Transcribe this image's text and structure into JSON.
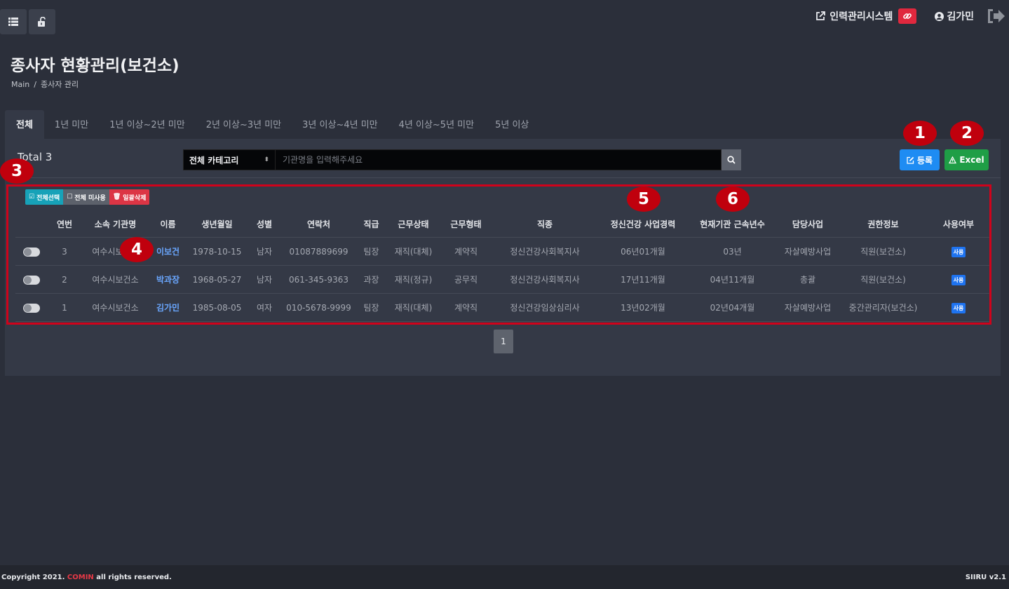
{
  "header": {
    "system_link_label": "인력관리시스템",
    "user_name": "김가민"
  },
  "page": {
    "title": "종사자 현황관리(보건소)",
    "breadcrumb": [
      "Main",
      "종사자 관리"
    ]
  },
  "tabs": [
    {
      "label": "전체",
      "active": true
    },
    {
      "label": "1년 미만"
    },
    {
      "label": "1년 이상~2년 미만"
    },
    {
      "label": "2년 이상~3년 미만"
    },
    {
      "label": "3년 이상~4년 미만"
    },
    {
      "label": "4년 이상~5년 미만"
    },
    {
      "label": "5년 이상"
    }
  ],
  "toolbar": {
    "total_label": "Total 3",
    "category_select": "전체 카테고리",
    "search_placeholder": "기관명을 입력해주세요",
    "register_label": "등록",
    "excel_label": "Excel"
  },
  "bulk_actions": {
    "select_all": "전체선택",
    "unuse_all": "전체 미사용",
    "bulk_delete": "일괄삭제"
  },
  "table": {
    "columns": [
      "",
      "연번",
      "소속 기관명",
      "이름",
      "생년월일",
      "성별",
      "연락처",
      "직급",
      "근무상태",
      "근무형태",
      "직종",
      "정신건강 사업경력",
      "현재기관 근속년수",
      "담당사업",
      "권한정보",
      "사용여부"
    ],
    "rows": [
      {
        "no": "3",
        "org": "여수시보건소",
        "name": "이보건",
        "birth": "1978-10-15",
        "gender": "남자",
        "phone": "01087889699",
        "rank": "팀장",
        "status": "재직(대체)",
        "type": "계약직",
        "job": "정신건강사회복지사",
        "career": "06년01개월",
        "tenure": "03년",
        "project": "자살예방사업",
        "role": "직원(보건소)",
        "use": "사용"
      },
      {
        "no": "2",
        "org": "여수시보건소",
        "name": "박과장",
        "birth": "1968-05-27",
        "gender": "남자",
        "phone": "061-345-9363",
        "rank": "과장",
        "status": "재직(정규)",
        "type": "공무직",
        "job": "정신건강사회복지사",
        "career": "17년11개월",
        "tenure": "04년11개월",
        "project": "총괄",
        "role": "직원(보건소)",
        "use": "사용"
      },
      {
        "no": "1",
        "org": "여수시보건소",
        "name": "김가민",
        "birth": "1985-08-05",
        "gender": "여자",
        "phone": "010-5678-9999",
        "rank": "팀장",
        "status": "재직(대체)",
        "type": "계약직",
        "job": "정신건강임상심리사",
        "career": "13년02개월",
        "tenure": "02년04개월",
        "project": "자살예방사업",
        "role": "중간관리자(보건소)",
        "use": "사용"
      }
    ]
  },
  "pagination": {
    "current": "1"
  },
  "annotations": [
    "1",
    "2",
    "3",
    "4",
    "5",
    "6"
  ],
  "footer": {
    "copyright_prefix": "Copyright 2021.",
    "brand": "COMIN",
    "copyright_suffix": "all rights reserved.",
    "version": "SIIRU v2.1"
  },
  "colors": {
    "background": "#2b2f3a",
    "panel": "#343946",
    "primary": "#1e8cf3",
    "success": "#1f9e46",
    "danger": "#dc3545",
    "info": "#17a2b8",
    "annotation": "#c0000d"
  }
}
